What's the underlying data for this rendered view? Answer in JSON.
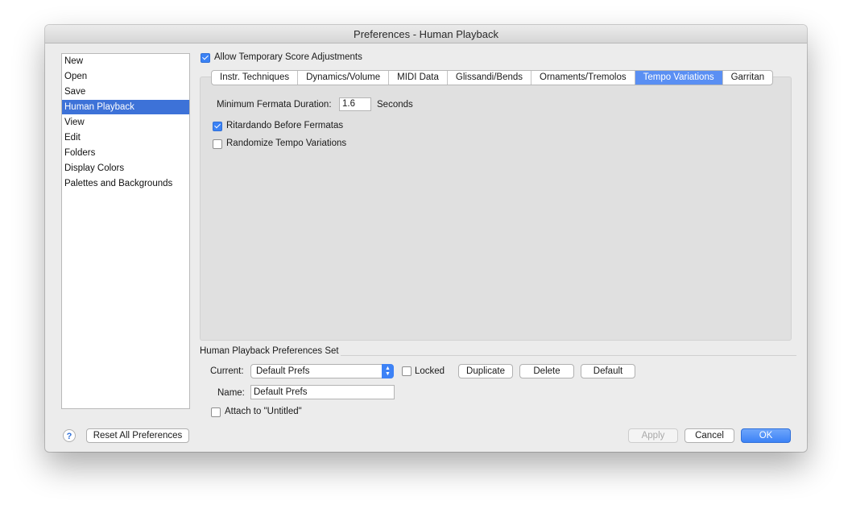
{
  "window": {
    "title": "Preferences - Human Playback"
  },
  "sidebar": {
    "items": [
      {
        "label": "New"
      },
      {
        "label": "Open"
      },
      {
        "label": "Save"
      },
      {
        "label": "Human Playback"
      },
      {
        "label": "View"
      },
      {
        "label": "Edit"
      },
      {
        "label": "Folders"
      },
      {
        "label": "Display Colors"
      },
      {
        "label": "Palettes and Backgrounds"
      }
    ],
    "selected": "Human Playback"
  },
  "allow_temp": {
    "label": "Allow Temporary Score Adjustments",
    "checked": true
  },
  "tabs": [
    {
      "label": "Instr. Techniques"
    },
    {
      "label": "Dynamics/Volume"
    },
    {
      "label": "MIDI Data"
    },
    {
      "label": "Glissandi/Bends"
    },
    {
      "label": "Ornaments/Tremolos"
    },
    {
      "label": "Tempo Variations"
    },
    {
      "label": "Garritan"
    }
  ],
  "active_tab": "Tempo Variations",
  "tempo": {
    "min_fermata_label": "Minimum Fermata Duration:",
    "min_fermata_value": "1.6",
    "seconds_label": "Seconds",
    "ritardando": {
      "label": "Ritardando Before Fermatas",
      "checked": true
    },
    "randomize": {
      "label": "Randomize Tempo Variations",
      "checked": false
    }
  },
  "prefs_set": {
    "title": "Human Playback Preferences Set",
    "current_label": "Current:",
    "current_value": "Default Prefs",
    "locked_label": "Locked",
    "locked_checked": false,
    "duplicate": "Duplicate",
    "delete": "Delete",
    "default": "Default",
    "name_label": "Name:",
    "name_value": "Default Prefs",
    "attach_label": "Attach to \"Untitled\"",
    "attach_checked": false
  },
  "footer": {
    "help": "?",
    "reset": "Reset All Preferences",
    "apply": "Apply",
    "cancel": "Cancel",
    "ok": "OK"
  },
  "colors": {
    "accent": "#3d72d8",
    "active_tab": "#5a8ff3",
    "ok_button": "#3c82f6"
  }
}
